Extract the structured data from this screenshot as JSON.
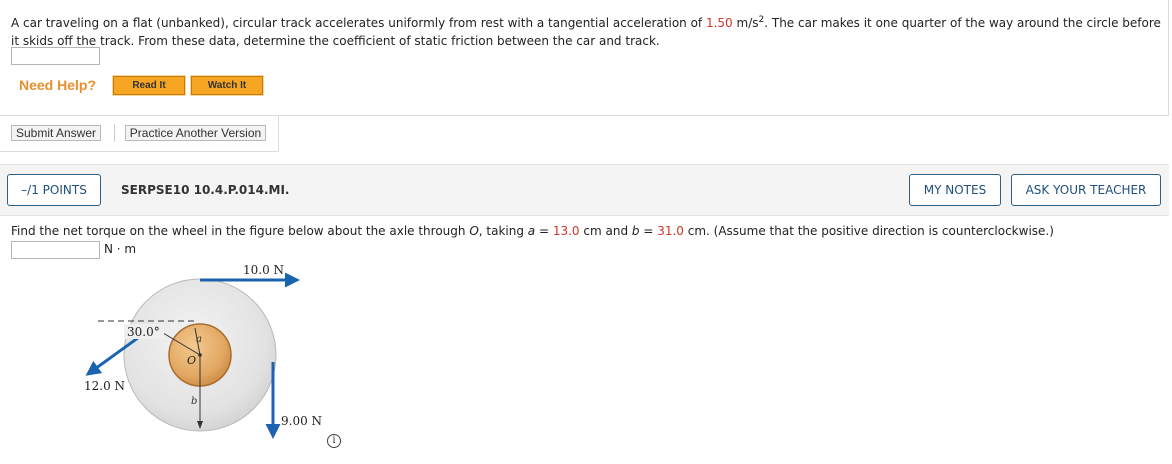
{
  "q1": {
    "text_part1": "A car traveling on a flat (unbanked), circular track accelerates uniformly from rest with a tangential acceleration of ",
    "accel_value": "1.50",
    "text_part2": " m/s",
    "exponent": "2",
    "text_part3": ". The car makes it one quarter of the way around the circle before it skids off the track. From these data, determine the coefficient of static friction between the car and track.",
    "answer_value": "",
    "need_help_label": "Need Help?",
    "read_it_label": "Read It",
    "watch_it_label": "Watch It"
  },
  "actions": {
    "submit_label": "Submit Answer",
    "practice_label": "Practice Another Version"
  },
  "q2": {
    "points_label": "–/1 POINTS",
    "code": "SERPSE10 10.4.P.014.MI.",
    "my_notes_label": "MY NOTES",
    "ask_teacher_label": "ASK YOUR TEACHER",
    "text_part1": "Find the net torque on the wheel in the figure below about the axle through ",
    "axle_label": "O",
    "text_part2": ", taking ",
    "a_var": "a",
    "eq": " = ",
    "a_value": "13.0",
    "text_part3": " cm and ",
    "b_var": "b",
    "b_value": "31.0",
    "text_part4": " cm. (Assume that the positive direction is counterclockwise.)",
    "answer_value": "",
    "unit": "N · m",
    "figure": {
      "force_top": "10.0 N",
      "angle": "30.0°",
      "force_left": "12.0 N",
      "force_right": "9.00 N",
      "label_a": "a",
      "label_o": "O",
      "label_b": "b"
    },
    "info_icon": "i"
  },
  "colors": {
    "highlight_red": "#d0352a",
    "need_help_orange": "#e8902e",
    "help_button": "#f6a623",
    "arrow_blue": "#1b63b0",
    "outline_button": "#2c5f8a"
  }
}
